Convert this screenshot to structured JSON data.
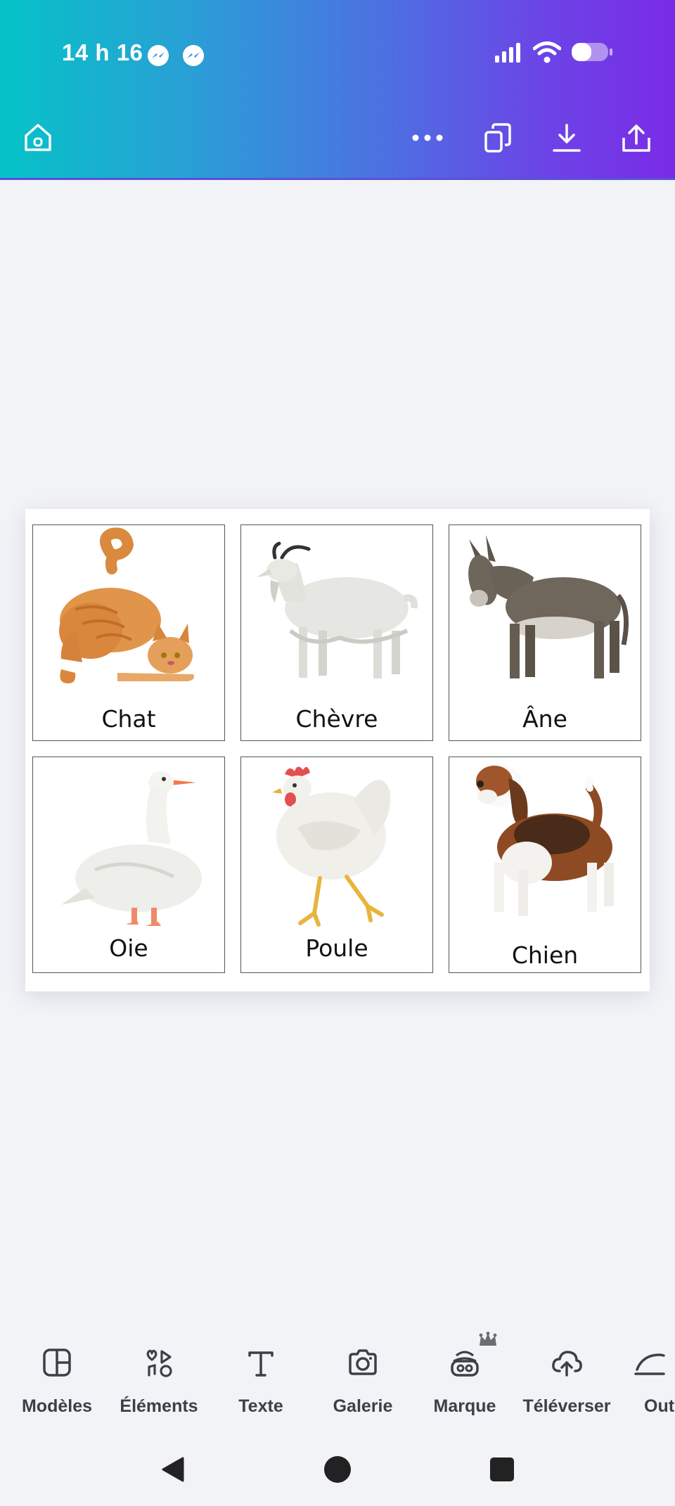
{
  "status_bar": {
    "time": "14 h 16",
    "notification_icons": [
      "messenger-icon",
      "messenger-icon"
    ],
    "system_icons": [
      "signal-icon",
      "wifi-icon",
      "battery-icon"
    ]
  },
  "top_toolbar": {
    "left": [
      "home-icon"
    ],
    "right": [
      "more-icon",
      "duplicate-icon",
      "download-icon",
      "share-icon"
    ]
  },
  "design": {
    "cards": [
      {
        "label": "Chat",
        "image": "cat-illustration"
      },
      {
        "label": "Chèvre",
        "image": "goat-illustration"
      },
      {
        "label": "Âne",
        "image": "donkey-illustration"
      },
      {
        "label": "Oie",
        "image": "goose-illustration"
      },
      {
        "label": "Poule",
        "image": "hen-illustration"
      },
      {
        "label": "Chien",
        "image": "beagle-illustration"
      }
    ]
  },
  "bottom_toolbar": {
    "items": [
      {
        "label": "Modèles",
        "icon": "templates-icon"
      },
      {
        "label": "Éléments",
        "icon": "elements-icon"
      },
      {
        "label": "Texte",
        "icon": "text-icon"
      },
      {
        "label": "Galerie",
        "icon": "camera-icon"
      },
      {
        "label": "Marque",
        "icon": "brand-icon",
        "badge": "crown-icon"
      },
      {
        "label": "Téléverser",
        "icon": "upload-icon"
      },
      {
        "label": "Out",
        "icon": "tools-icon"
      }
    ]
  },
  "nav_bar": [
    "back-icon",
    "home-circle-icon",
    "recents-icon"
  ],
  "colors": {
    "gradient_start": "#05c3c7",
    "gradient_end": "#7a2be6",
    "canvas_bg": "#f2f3f7",
    "label_text": "#3c4046"
  }
}
